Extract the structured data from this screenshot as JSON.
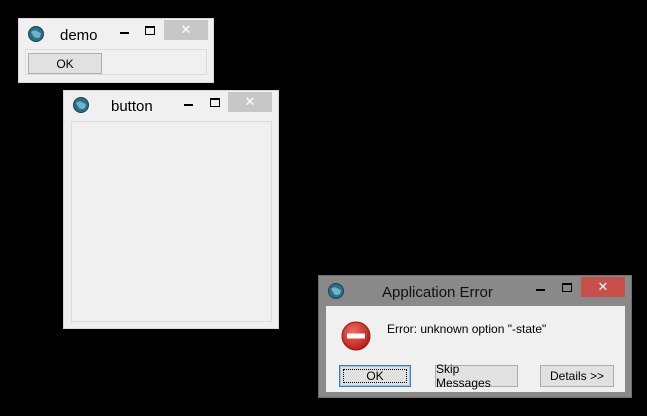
{
  "windows": {
    "demo": {
      "title": "demo",
      "ok_label": "OK",
      "close_glyph": "✕"
    },
    "button": {
      "title": "button",
      "close_glyph": "✕"
    },
    "error": {
      "title": "Application Error",
      "message": "Error: unknown option \"-state\"",
      "ok_label": "OK",
      "skip_label": "Skip Messages",
      "details_label": "Details >>",
      "close_glyph": "✕"
    }
  },
  "colors": {
    "desktop": "#000000",
    "window_face": "#f0f0f0",
    "inactive_close": "#c7c7c7",
    "active_close": "#c7504a",
    "error_frame": "#898989",
    "error_icon": "#d9342b"
  },
  "icons": {
    "app_icon": "tk-globe-icon",
    "minimize": "minimize-icon",
    "maximize": "maximize-icon",
    "close": "close-icon",
    "error": "error-stop-icon"
  }
}
